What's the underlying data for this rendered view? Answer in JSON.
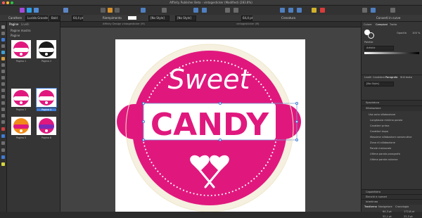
{
  "window": {
    "title": "Affinity Publisher Beta - vintagesticker (Modified) (283.8%)"
  },
  "context_bar": {
    "f1_label": "Carattere",
    "font_name": "Lucida Grande",
    "style": "Bold",
    "size": "64,4 pt",
    "color_label": "Riempimento",
    "style2": "[No Style]",
    "style3": "[No Style]",
    "size2": "64,4 pt",
    "track_label": "Crenatura",
    "convert_label": "Converti in curve"
  },
  "pages_panel": {
    "tabs": [
      "Pagine",
      "Livelli"
    ],
    "master_section": "Pagine mastro",
    "pages_section": "Pagine",
    "thumbs": [
      {
        "label": "Pagina 1",
        "color": "#e0187e"
      },
      {
        "label": "Pagina 2",
        "color": "#1b1b1b"
      },
      {
        "label": "Pagina 3",
        "color": "#e0187e"
      },
      {
        "label": "Pagina 4",
        "color": "#e0187e"
      },
      {
        "label": "Pagina 5",
        "color": "#f08a18"
      },
      {
        "label": "Pagina 6",
        "color": "#e0187e"
      }
    ]
  },
  "doc_tabs": [
    "Affinity Design vintagesticker (M)",
    "vintagesticker (M)"
  ],
  "artwork": {
    "top_text": "Sweet",
    "main_text": "CANDY",
    "brand_color": "#e0187e",
    "cream": "#f5f0e0"
  },
  "right_panel": {
    "tabs": [
      "Colore",
      "Campioni",
      "Tratto"
    ],
    "opacity_label": "Opacità",
    "opacity": "100 %",
    "swatches_label": "Palette",
    "swatch_set": "Artistic",
    "para_tabs": [
      "Livelli",
      "Carattere",
      "Paragrafo",
      "Stili testo"
    ],
    "style_value": "[No Style]",
    "sections": [
      "Spaziatura",
      "Sillabazione",
      "Capolettera",
      "Elenchi e numeri",
      "Interlinea",
      "Trasforma"
    ],
    "hyph_rows": [
      "Usa auto sillabazione",
      "Lunghezza minima parola",
      "Caratteri prima",
      "Caratteri dopo",
      "Massime sillabazioni consecutive",
      "Zona di sillabazione",
      "Parole maiuscole",
      "Ultima parola paragrafo",
      "Ultima parola colonna"
    ],
    "transform_tabs": [
      "Trasforma",
      "Navigatore",
      "Cronologia"
    ],
    "transform_values": {
      "x": "64,3 pt",
      "y": "52,1 pt",
      "w": "172,8 pt",
      "h": "22,3 pt"
    }
  }
}
